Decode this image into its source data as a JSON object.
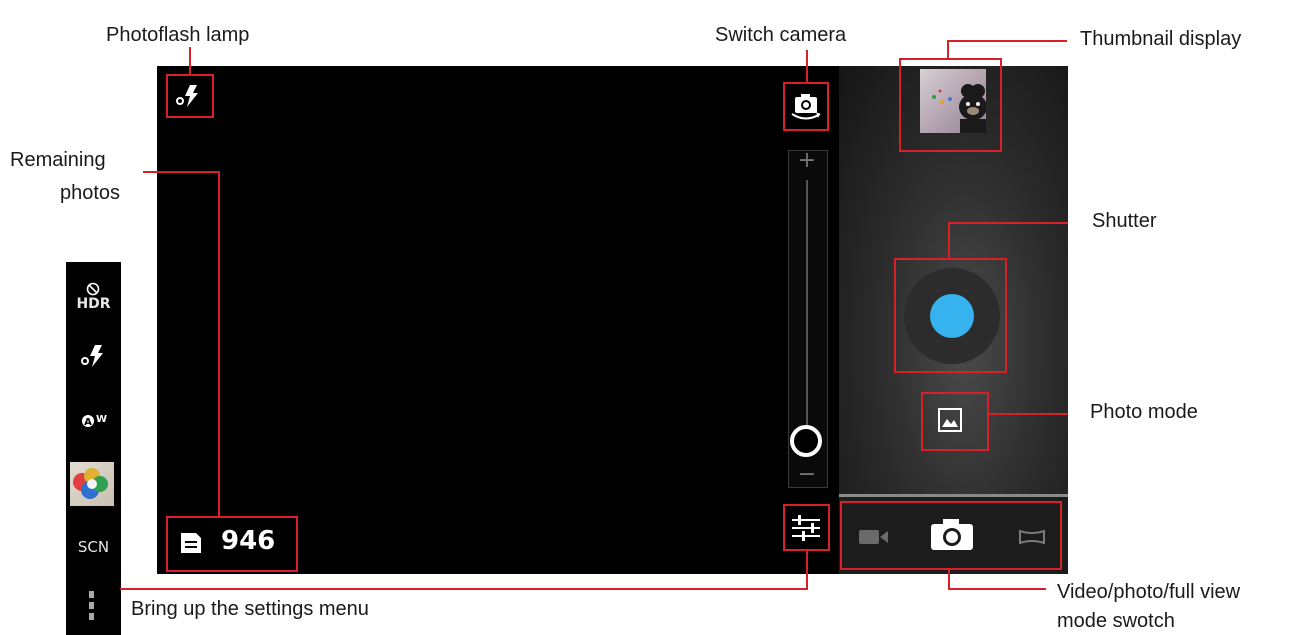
{
  "annotations": {
    "photoflash_lamp": "Photoflash lamp",
    "switch_camera": "Switch camera",
    "thumbnail_display": "Thumbnail display",
    "remaining_photos_line1": "Remaining",
    "remaining_photos_line2": "photos",
    "shutter": "Shutter",
    "photo_mode": "Photo mode",
    "settings_menu": "Bring up the settings menu",
    "mode_switch_line1": "Video/photo/full view",
    "mode_switch_line2": "mode swotch"
  },
  "camera": {
    "remaining_count": "946",
    "zoom_plus": "+",
    "zoom_minus": "−",
    "zoom_level": 0.0
  },
  "sidebar": {
    "hdr_label": "HDR",
    "scene_label": "SCN",
    "wb_label": "W"
  },
  "colors": {
    "annotation_red": "#d8202a",
    "shutter_blue": "#36b2ee"
  },
  "icons": [
    "flash-auto-icon",
    "switch-camera-icon",
    "settings-sliders-icon",
    "sd-card-icon",
    "video-icon",
    "camera-icon",
    "panorama-icon",
    "photo-mode-icon",
    "hdr-off-icon",
    "white-balance-icon",
    "more-icon"
  ]
}
